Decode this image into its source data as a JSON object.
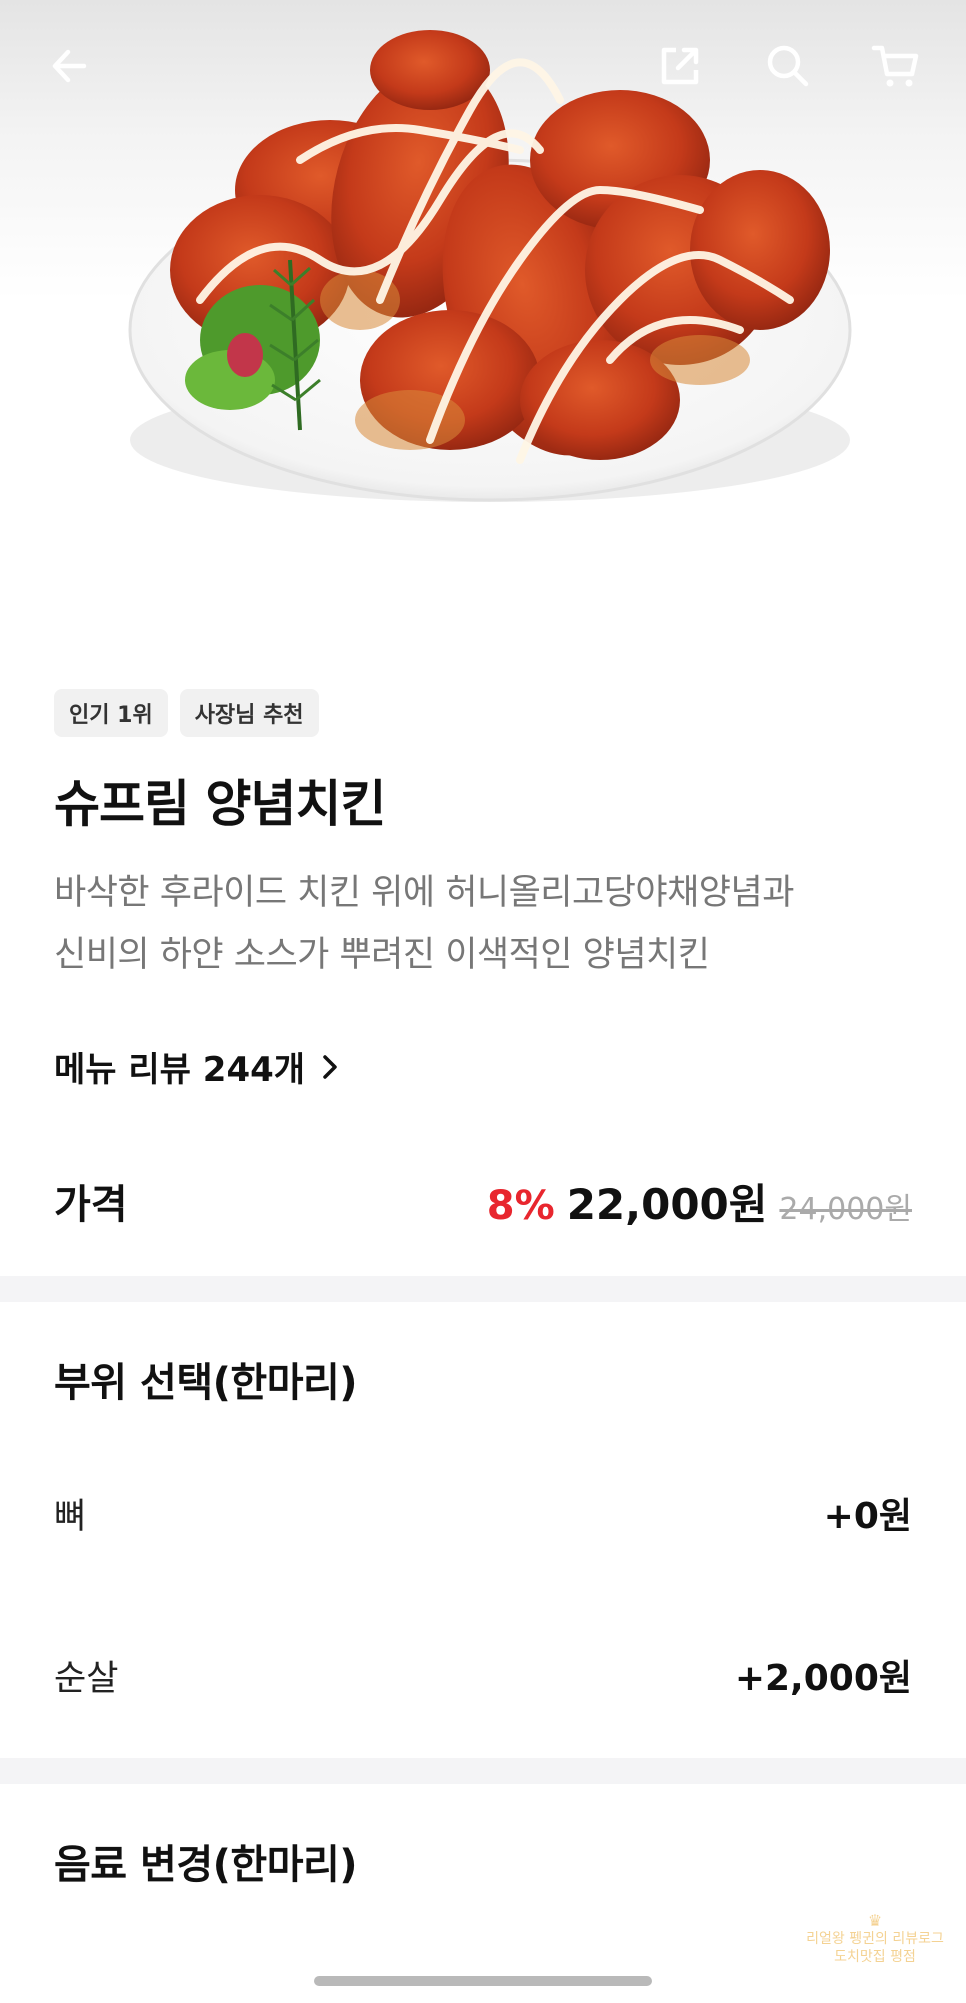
{
  "nav": {
    "back_icon": "arrow-left-icon",
    "share_icon": "share-icon",
    "search_icon": "search-icon",
    "cart_icon": "cart-icon"
  },
  "product": {
    "image_icon": "fried-chicken-image",
    "badges": [
      "인기 1위",
      "사장님 추천"
    ],
    "name": "슈프림 양념치킨",
    "description_line1": "바삭한 후라이드 치킨 위에 허니올리고당야채양념과",
    "description_line2": "신비의 하얀 소스가 뿌려진 이색적인 양념치킨",
    "review_link": "메뉴 리뷰 244개"
  },
  "price": {
    "label": "가격",
    "discount": "8%",
    "current": "22,000원",
    "original": "24,000원"
  },
  "part_section": {
    "title": "부위 선택(한마리)",
    "options": [
      {
        "label": "뼈",
        "price": "+0원"
      },
      {
        "label": "순살",
        "price": "+2,000원"
      }
    ]
  },
  "drink_section": {
    "title": "음료 변경(한마리)"
  },
  "watermark": {
    "line1": "리얼왕 펭귄의 리뷰로그",
    "line2": "도치맛집 평점"
  },
  "colors": {
    "discount": "#e8262e",
    "divider": "#f4f4f6",
    "badge_bg": "#f1f1f1"
  }
}
